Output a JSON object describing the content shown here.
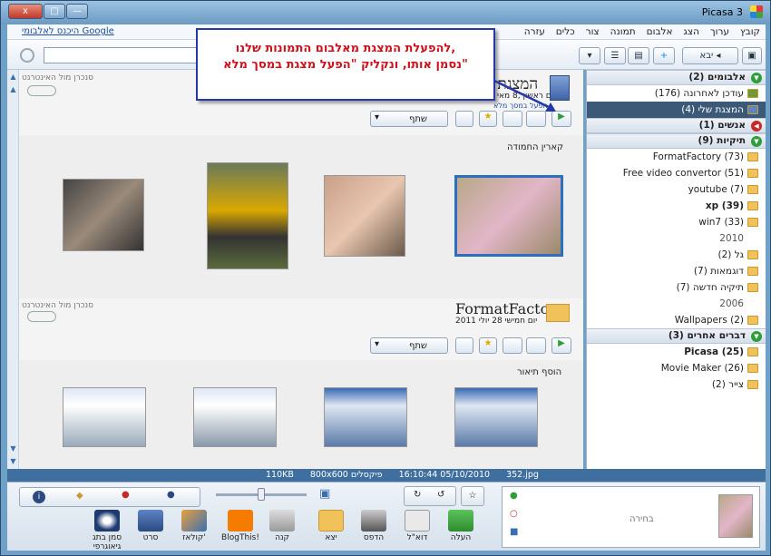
{
  "window": {
    "title": "Picasa 3",
    "close": "x",
    "max": "□",
    "min": "—"
  },
  "menu": [
    "קובץ",
    "ערוך",
    "הצג",
    "אלבום",
    "תמונה",
    "צור",
    "כלים",
    "עזרה"
  ],
  "signin": "היכנס לאלבומי Google",
  "toolbar": {
    "import": "יבא"
  },
  "callout": {
    "line1": "להפעלת המצגת מאלבום התמונות שלנו,",
    "line2": "נסמן אותו, ונקליק \"הפעל מצגת במסך מלא\""
  },
  "albums": [
    {
      "title": "המצגת של",
      "date": "יום ראשון ,8 מאי",
      "sub": "הפעל במסך מלא",
      "sync": "סנכרן מול האינטרנט",
      "share": "שתף",
      "caption": "קארין החמודה"
    },
    {
      "title": "FormatFactory",
      "date": "יום חמישי 28 יולי 2011",
      "sync": "סנכרן מול האינטרנט",
      "share": "שתף",
      "caption": "הוסף תיאור"
    }
  ],
  "sidebar": {
    "sections": [
      {
        "label": "אלבומים (2)",
        "color": "#2e9e3a",
        "rows": [
          {
            "t": "עודכן לאחרונה (176)"
          },
          {
            "t": "המצגת שלי (4)",
            "sel": true
          }
        ]
      },
      {
        "label": "אנשים (1)",
        "color": "#c62828",
        "rows": []
      },
      {
        "label": "תיקיות (9)",
        "color": "#2e9e3a",
        "rows": [
          {
            "t": "FormatFactory (73)"
          },
          {
            "t": "Free video convertor (51)"
          },
          {
            "t": "youtube (7)"
          },
          {
            "t": "xp (39)",
            "b": true
          },
          {
            "t": "win7 (33)"
          },
          {
            "t": "2010",
            "y": true
          },
          {
            "t": "גל (2)"
          },
          {
            "t": "דוגמאות (7)"
          },
          {
            "t": "תיקיה חדשה (7)"
          },
          {
            "t": "2006",
            "y": true
          },
          {
            "t": "Wallpapers (2)"
          }
        ]
      },
      {
        "label": "דברים אחרים (3)",
        "color": "#2e9e3a",
        "rows": [
          {
            "t": "Picasa (25)",
            "b": true
          },
          {
            "t": "Movie Maker (26)"
          },
          {
            "t": "צייר (2)"
          }
        ]
      }
    ]
  },
  "status": {
    "file": "352.jpg",
    "datetime": "16:10:44 05/10/2010",
    "dims": "800x600 פיקסלים",
    "size": "110KB"
  },
  "bottom": {
    "selection": "בחירה",
    "actions": [
      "העלה",
      "דוא\"ל",
      "הדפס",
      "יצא",
      "קנה",
      "BlogThis!",
      "קולאז'",
      "סרט",
      "סמן בתג גיאוגרפי"
    ]
  }
}
